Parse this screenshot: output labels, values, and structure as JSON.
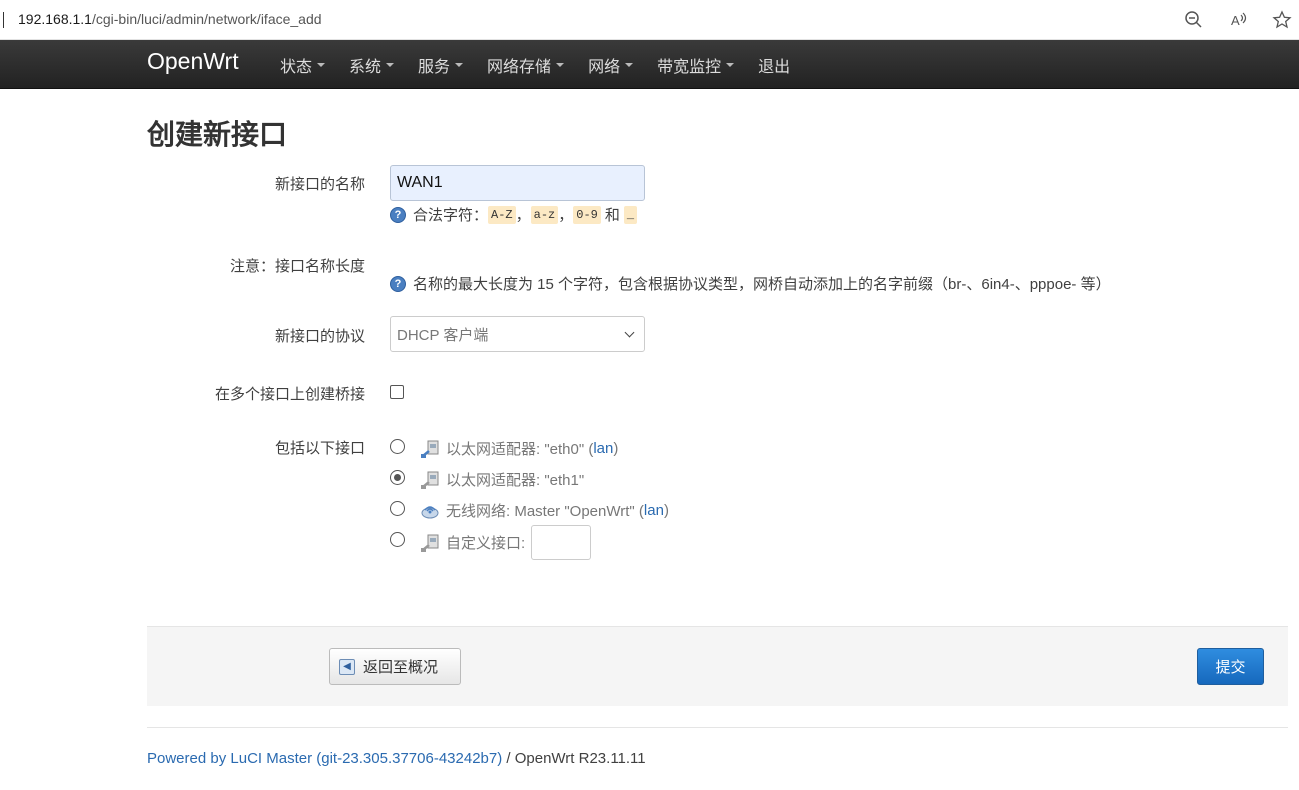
{
  "browser": {
    "url_host": "192.168.1.1",
    "url_path": "/cgi-bin/luci/admin/network/iface_add"
  },
  "navbar": {
    "brand": "OpenWrt",
    "menu": [
      {
        "label": "状态",
        "dropdown": true
      },
      {
        "label": "系统",
        "dropdown": true
      },
      {
        "label": "服务",
        "dropdown": true
      },
      {
        "label": "网络存储",
        "dropdown": true
      },
      {
        "label": "网络",
        "dropdown": true
      },
      {
        "label": "带宽监控",
        "dropdown": true
      },
      {
        "label": "退出",
        "dropdown": false
      }
    ]
  },
  "page": {
    "title": "创建新接口"
  },
  "form": {
    "name_label": "新接口的名称",
    "name_value": "WAN1",
    "name_help_prefix": "合法字符：",
    "name_help_codes": [
      "A-Z",
      "a-z",
      "0-9",
      "_"
    ],
    "name_help_sep": "，",
    "name_help_and": "和",
    "note_label": "注意：接口名称长度",
    "note_help": "名称的最大长度为 15 个字符，包含根据协议类型，网桥自动添加上的名字前缀（br-、6in4-、pppoe- 等）",
    "protocol_label": "新接口的协议",
    "protocol_value": "DHCP 客户端",
    "bridge_label": "在多个接口上创建桥接",
    "bridge_checked": false,
    "include_label": "包括以下接口",
    "interfaces": [
      {
        "text": "以太网适配器: \"eth0\" (",
        "link": "lan",
        "suffix": ")",
        "checked": false,
        "icon": "ethernet-icon"
      },
      {
        "text": "以太网适配器: \"eth1\"",
        "link": "",
        "suffix": "",
        "checked": true,
        "icon": "ethernet-icon"
      },
      {
        "text": "无线网络: Master \"OpenWrt\" (",
        "link": "lan",
        "suffix": ")",
        "checked": false,
        "icon": "wifi-icon"
      },
      {
        "text": "自定义接口:",
        "link": "",
        "suffix": "",
        "checked": false,
        "icon": "ethernet-icon"
      }
    ],
    "custom_value": ""
  },
  "actions": {
    "back_label": "返回至概况",
    "submit_label": "提交"
  },
  "footer": {
    "powered_link": "Powered by LuCI Master (git-23.305.37706-43242b7)",
    "version_text": " / OpenWrt R23.11.11"
  },
  "colors": {
    "navbar_bg": "#222222",
    "link": "#2a6ab0",
    "primary_button": "#1668bd"
  }
}
